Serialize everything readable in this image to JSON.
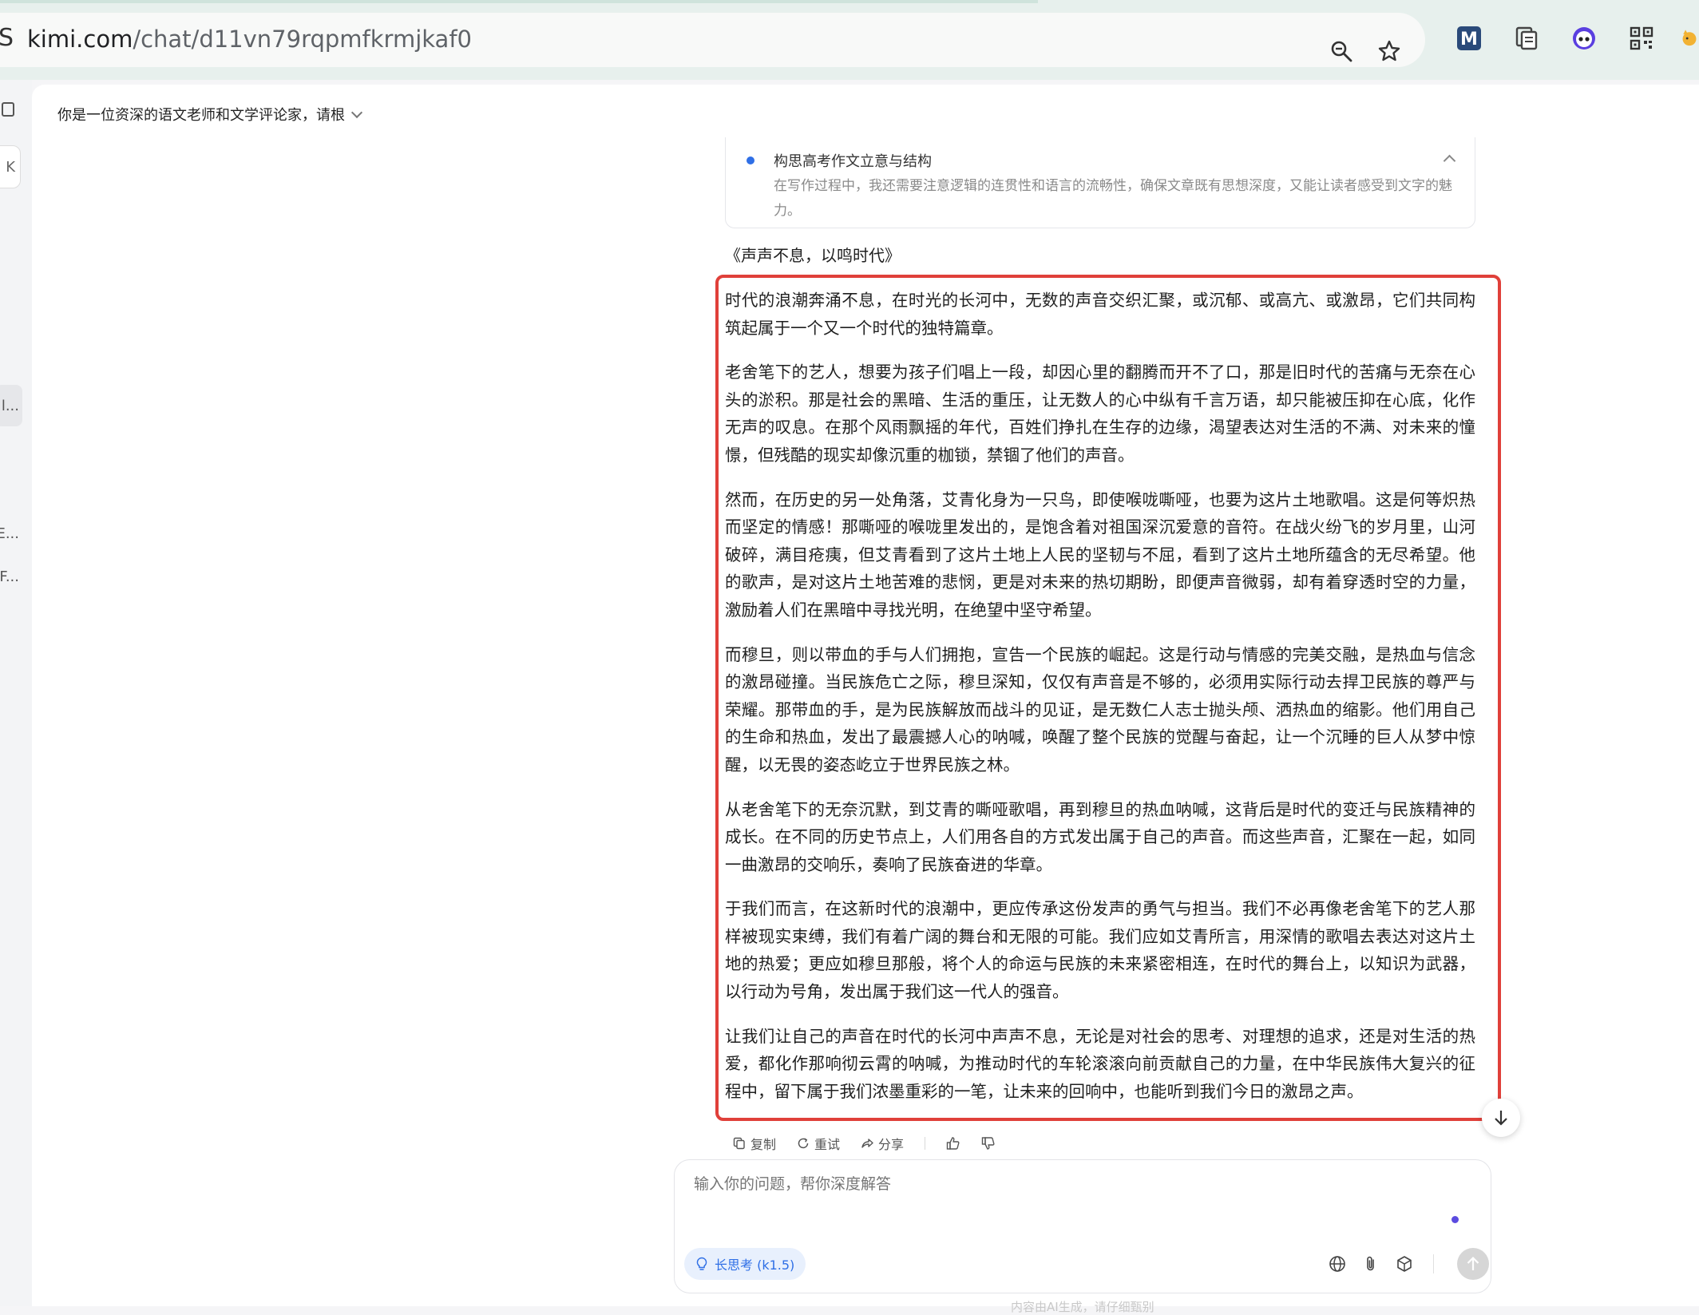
{
  "browser": {
    "site_glyph": "S",
    "url_host": "kimi.com",
    "url_path": "/chat/d11vn79rqpmfkrmjkaf0",
    "icons": [
      "zoom-icon",
      "bookmark-star-icon"
    ],
    "extensions": [
      "m-extension-icon",
      "copy-extension-icon",
      "robot-extension-icon",
      "qr-code-extension-icon",
      "cat-extension-icon"
    ]
  },
  "sidebar": {
    "shortcut_label": "K",
    "items": [
      "l...",
      "E...",
      "F..."
    ]
  },
  "chat": {
    "topic": "你是一位资深的语文老师和文学评论家，请根",
    "thinking": {
      "title": "构思高考作文立意与结构",
      "body": "在写作过程中，我还需要注意逻辑的连贯性和语言的流畅性，确保文章既有思想深度，又能让读者感受到文字的魅力。"
    },
    "essay_title": "《声声不息，以鸣时代》",
    "paragraphs": [
      "时代的浪潮奔涌不息，在时光的长河中，无数的声音交织汇聚，或沉郁、或高亢、或激昂，它们共同构筑起属于一个又一个时代的独特篇章。",
      "老舍笔下的艺人，想要为孩子们唱上一段，却因心里的翻腾而开不了口，那是旧时代的苦痛与无奈在心头的淤积。那是社会的黑暗、生活的重压，让无数人的心中纵有千言万语，却只能被压抑在心底，化作无声的叹息。在那个风雨飘摇的年代，百姓们挣扎在生存的边缘，渴望表达对生活的不满、对未来的憧憬，但残酷的现实却像沉重的枷锁，禁锢了他们的声音。",
      "然而，在历史的另一处角落，艾青化身为一只鸟，即使喉咙嘶哑，也要为这片土地歌唱。这是何等炽热而坚定的情感！那嘶哑的喉咙里发出的，是饱含着对祖国深沉爱意的音符。在战火纷飞的岁月里，山河破碎，满目疮痍，但艾青看到了这片土地上人民的坚韧与不屈，看到了这片土地所蕴含的无尽希望。他的歌声，是对这片土地苦难的悲悯，更是对未来的热切期盼，即便声音微弱，却有着穿透时空的力量，激励着人们在黑暗中寻找光明，在绝望中坚守希望。",
      "而穆旦，则以带血的手与人们拥抱，宣告一个民族的崛起。这是行动与情感的完美交融，是热血与信念的激昂碰撞。当民族危亡之际，穆旦深知，仅仅有声音是不够的，必须用实际行动去捍卫民族的尊严与荣耀。那带血的手，是为民族解放而战斗的见证，是无数仁人志士抛头颅、洒热血的缩影。他们用自己的生命和热血，发出了最震撼人心的呐喊，唤醒了整个民族的觉醒与奋起，让一个沉睡的巨人从梦中惊醒，以无畏的姿态屹立于世界民族之林。",
      "从老舍笔下的无奈沉默，到艾青的嘶哑歌唱，再到穆旦的热血呐喊，这背后是时代的变迁与民族精神的成长。在不同的历史节点上，人们用各自的方式发出属于自己的声音。而这些声音，汇聚在一起，如同一曲激昂的交响乐，奏响了民族奋进的华章。",
      "于我们而言，在这新时代的浪潮中，更应传承这份发声的勇气与担当。我们不必再像老舍笔下的艺人那样被现实束缚，我们有着广阔的舞台和无限的可能。我们应如艾青所言，用深情的歌唱去表达对这片土地的热爱；更应如穆旦那般，将个人的命运与民族的未来紧密相连，在时代的舞台上，以知识为武器，以行动为号角，发出属于我们这一代人的强音。",
      "让我们让自己的声音在时代的长河中声声不息，无论是对社会的思考、对理想的追求，还是对生活的热爱，都化作那响彻云霄的呐喊，为推动时代的车轮滚滚向前贡献自己的力量，在中华民族伟大复兴的征程中，留下属于我们浓墨重彩的一笔，让未来的回响中，也能听到我们今日的激昂之声。"
    ],
    "actions": {
      "copy": "复制",
      "retry": "重试",
      "share": "分享"
    }
  },
  "composer": {
    "placeholder": "输入你的问题，帮你深度解答",
    "mode_label": "长思考 (k1.5)",
    "footnote": "内容由AI生成，请仔细甄别"
  },
  "colors": {
    "highlight_border": "#e0403a",
    "accent_blue": "#2f6fe6",
    "chip_bg": "#e8f0fd"
  }
}
